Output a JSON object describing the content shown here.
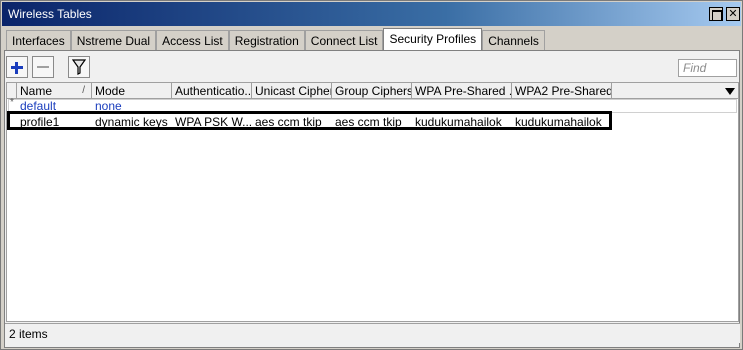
{
  "window": {
    "title": "Wireless Tables"
  },
  "tabs": [
    {
      "label": "Interfaces"
    },
    {
      "label": "Nstreme Dual"
    },
    {
      "label": "Access List"
    },
    {
      "label": "Registration"
    },
    {
      "label": "Connect List"
    },
    {
      "label": "Security Profiles",
      "active": true
    },
    {
      "label": "Channels"
    }
  ],
  "toolbar": {
    "find_placeholder": "Find"
  },
  "table": {
    "columns": [
      "Name",
      "Mode",
      "Authenticatio...",
      "Unicast Ciphers",
      "Group Ciphers",
      "WPA Pre-Shared ...",
      "WPA2 Pre-Shared..."
    ],
    "rows": [
      {
        "flag": "*",
        "name": "default",
        "mode": "none",
        "auth": "",
        "unicast": "",
        "group": "",
        "wpa_psk": "",
        "wpa2_psk": ""
      },
      {
        "flag": "",
        "name": "profile1",
        "mode": "dynamic keys",
        "auth": "WPA PSK W...",
        "unicast": "aes ccm tkip",
        "group": "aes ccm tkip",
        "wpa_psk": "kudukumahailok",
        "wpa2_psk": "kudukumahailok"
      }
    ]
  },
  "status": {
    "items": "2 items"
  },
  "colors": {
    "titlebar_start": "#0a246a",
    "default_row_text": "#1a3dbd",
    "add_icon": "#1a3dbd"
  }
}
